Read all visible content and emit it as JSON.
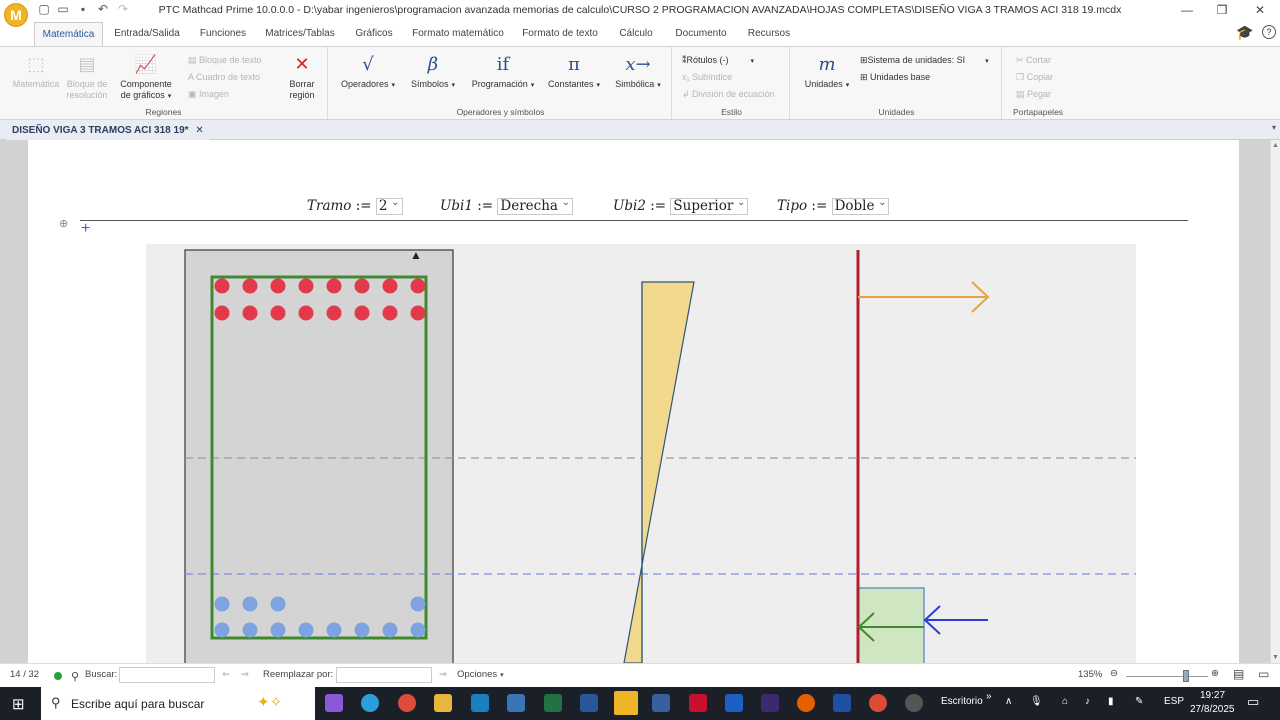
{
  "window": {
    "app_letter": "M",
    "title": "PTC Mathcad Prime 10.0.0.0 - D:\\yabar ingenieros\\programacion avanzada memorias de calculo\\CURSO 2 PROGRAMACION AVANZADA\\HOJAS COMPLETAS\\DISEÑO VIGA 3 TRAMOS ACI 318 19.mcdx",
    "minimize": "—",
    "restore": "❐",
    "close": "✕"
  },
  "tabs": [
    "Matemática",
    "Entrada/Salida",
    "Funciones",
    "Matrices/Tablas",
    "Gráficos",
    "Formato matemático",
    "Formato de texto",
    "Cálculo",
    "Documento",
    "Recursos"
  ],
  "active_tab": "Matemática",
  "ribbon": {
    "regions": {
      "label": "Regiones",
      "matematica": "Matemática",
      "bloque_resolucion": "Bloque de resolución",
      "componente_graficos": "Componente de gráficos",
      "bloque_texto": "Bloque de texto",
      "cuadro_texto": "Cuadro de texto",
      "imagen": "Imagen",
      "borrar_region": "Borrar región"
    },
    "operators": {
      "label": "Operadores y símbolos",
      "operadores": "Operadores",
      "simbolos": "Símbolos",
      "programacion": "Programación",
      "constantes": "Constantes",
      "simbolica": "Simbólica",
      "icon_operadores": "√",
      "icon_simbolos": "β",
      "icon_programacion": "if",
      "icon_constantes": "π",
      "icon_simbolica": "x→"
    },
    "style": {
      "label": "Estilo",
      "rotulos": "Rótulos",
      "rotulos_value": "(-)",
      "subindice": "Subíndice",
      "division": "División de ecuación"
    },
    "units": {
      "label": "Unidades",
      "unidades": "Unidades",
      "icon_unidades": "m",
      "sistema": "Sistema de unidades:",
      "sistema_value": "SI",
      "unidades_base": "Unidades base"
    },
    "clipboard": {
      "label": "Portapapeles",
      "cortar": "Cortar",
      "copiar": "Copiar",
      "pegar": "Pegar"
    }
  },
  "document_tab": {
    "title": "DISEÑO VIGA 3 TRAMOS ACI 318 19*",
    "close": "✕"
  },
  "worksheet": {
    "definitions": [
      {
        "var": "Tramo",
        "op": ":=",
        "value": "2"
      },
      {
        "var": "Ubi1",
        "op": ":=",
        "value": "Derecha"
      },
      {
        "var": "Ubi2",
        "op": ":=",
        "value": "Superior"
      },
      {
        "var": "Tipo",
        "op": ":=",
        "value": "Doble"
      }
    ],
    "section": {
      "top_bars_per_row": 8,
      "top_rows": 2,
      "bottom_row1_positions": [
        1,
        2,
        3,
        8
      ],
      "bottom_row2_bars": 8
    },
    "colors": {
      "concrete": "#d4d4d4",
      "stirrup": "#3f8a2f",
      "top_bar": "#e23a4a",
      "bottom_bar": "#7ea3e0",
      "strain": "#f3d98e",
      "axis": "#b01f2d",
      "tension_arrow": "#e8a23a",
      "compression_arrow": "#2b3fd6",
      "compression_block": "#cfe6c2"
    }
  },
  "status": {
    "page": "14 / 32",
    "buscar": "Buscar:",
    "reemplazar": "Reemplazar por:",
    "opciones": "Opciones",
    "zoom": "135%"
  },
  "taskbar": {
    "search_placeholder": "Escribe aquí para buscar",
    "escritorio": "Escritorio",
    "lang": "ESP",
    "time": "19:27",
    "date": "27/8/2025"
  }
}
